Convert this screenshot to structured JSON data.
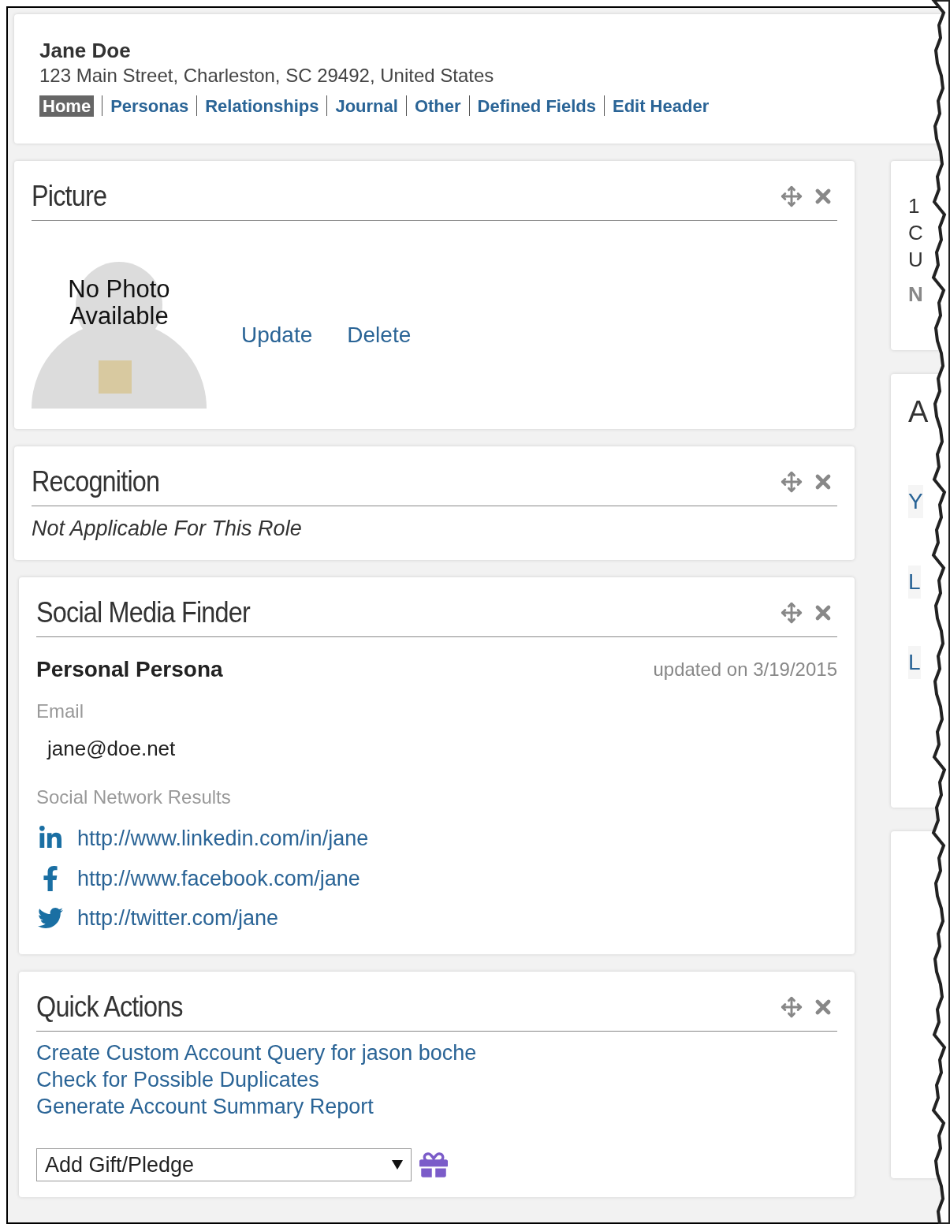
{
  "header": {
    "name": "Jane Doe",
    "address": "123 Main Street, Charleston, SC 29492, United States",
    "nav": [
      {
        "label": "Home",
        "selected": true
      },
      {
        "label": "Personas",
        "selected": false
      },
      {
        "label": "Relationships",
        "selected": false
      },
      {
        "label": "Journal",
        "selected": false
      },
      {
        "label": "Other",
        "selected": false
      },
      {
        "label": "Defined Fields",
        "selected": false
      },
      {
        "label": "Edit Header",
        "selected": false
      }
    ]
  },
  "picture_panel": {
    "title": "Picture",
    "no_photo_text": "No  Photo Available",
    "actions": [
      "Update",
      "Delete"
    ]
  },
  "recognition_panel": {
    "title": "Recognition",
    "note": "Not Applicable For This Role"
  },
  "social_panel": {
    "title": "Social Media Finder",
    "persona": "Personal Persona",
    "updated": "updated on 3/19/2015",
    "email_label": "Email",
    "email": "jane@doe.net",
    "results_label": "Social Network Results",
    "links": [
      {
        "kind": "linkedin",
        "url": "http://www.linkedin.com/in/jane"
      },
      {
        "kind": "facebook",
        "url": "http://www.facebook.com/jane"
      },
      {
        "kind": "twitter",
        "url": "http://twitter.com/jane"
      }
    ]
  },
  "quick_actions_panel": {
    "title": "Quick Actions",
    "actions": [
      "Create Custom Account Query for jason boche",
      "Check for Possible Duplicates",
      "Generate Account Summary Report"
    ],
    "select_value": "Add Gift/Pledge"
  },
  "side_cards": [
    {
      "lines": [
        "1",
        "C",
        "U"
      ],
      "note": "N"
    },
    {
      "title": "A",
      "items": [
        "Y",
        "L",
        "L"
      ]
    }
  ]
}
